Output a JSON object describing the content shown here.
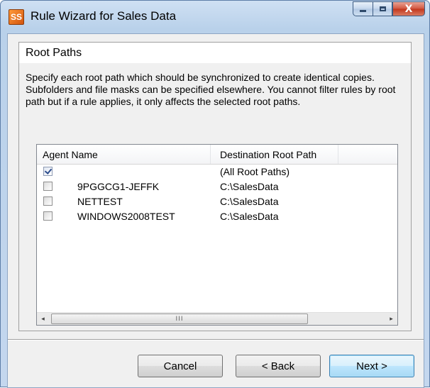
{
  "window": {
    "title": "Rule Wizard for Sales Data",
    "icon_text": "SS",
    "caption_buttons": [
      "minimize-icon",
      "maximize-icon",
      "close-icon"
    ],
    "close_glyph": "X"
  },
  "page": {
    "section_title": "Root Paths",
    "description": "Specify each root path which should be synchronized to create identical copies. Subfolders and file masks can be specified elsewhere. You cannot filter rules by root path but if a rule applies, it only affects the selected root paths."
  },
  "list": {
    "columns": [
      "Agent Name",
      "Destination Root Path"
    ],
    "rows": [
      {
        "checked": true,
        "agent": "",
        "destination": "(All Root Paths)"
      },
      {
        "checked": false,
        "agent": "9PGGCG1-JEFFK",
        "destination": "C:\\SalesData"
      },
      {
        "checked": false,
        "agent": "NETTEST",
        "destination": "C:\\SalesData"
      },
      {
        "checked": false,
        "agent": "WINDOWS2008TEST",
        "destination": "C:\\SalesData"
      }
    ],
    "scrollbar": {
      "left_arrow": "◂",
      "right_arrow": "▸",
      "thumb_grip": "III"
    }
  },
  "buttons": {
    "cancel": "Cancel",
    "back": "< Back",
    "next": "Next >"
  },
  "colors": {
    "default_button_border": "#3c7fb1",
    "title_bar": "#b9d1ea",
    "close_button": "#c2361c"
  }
}
